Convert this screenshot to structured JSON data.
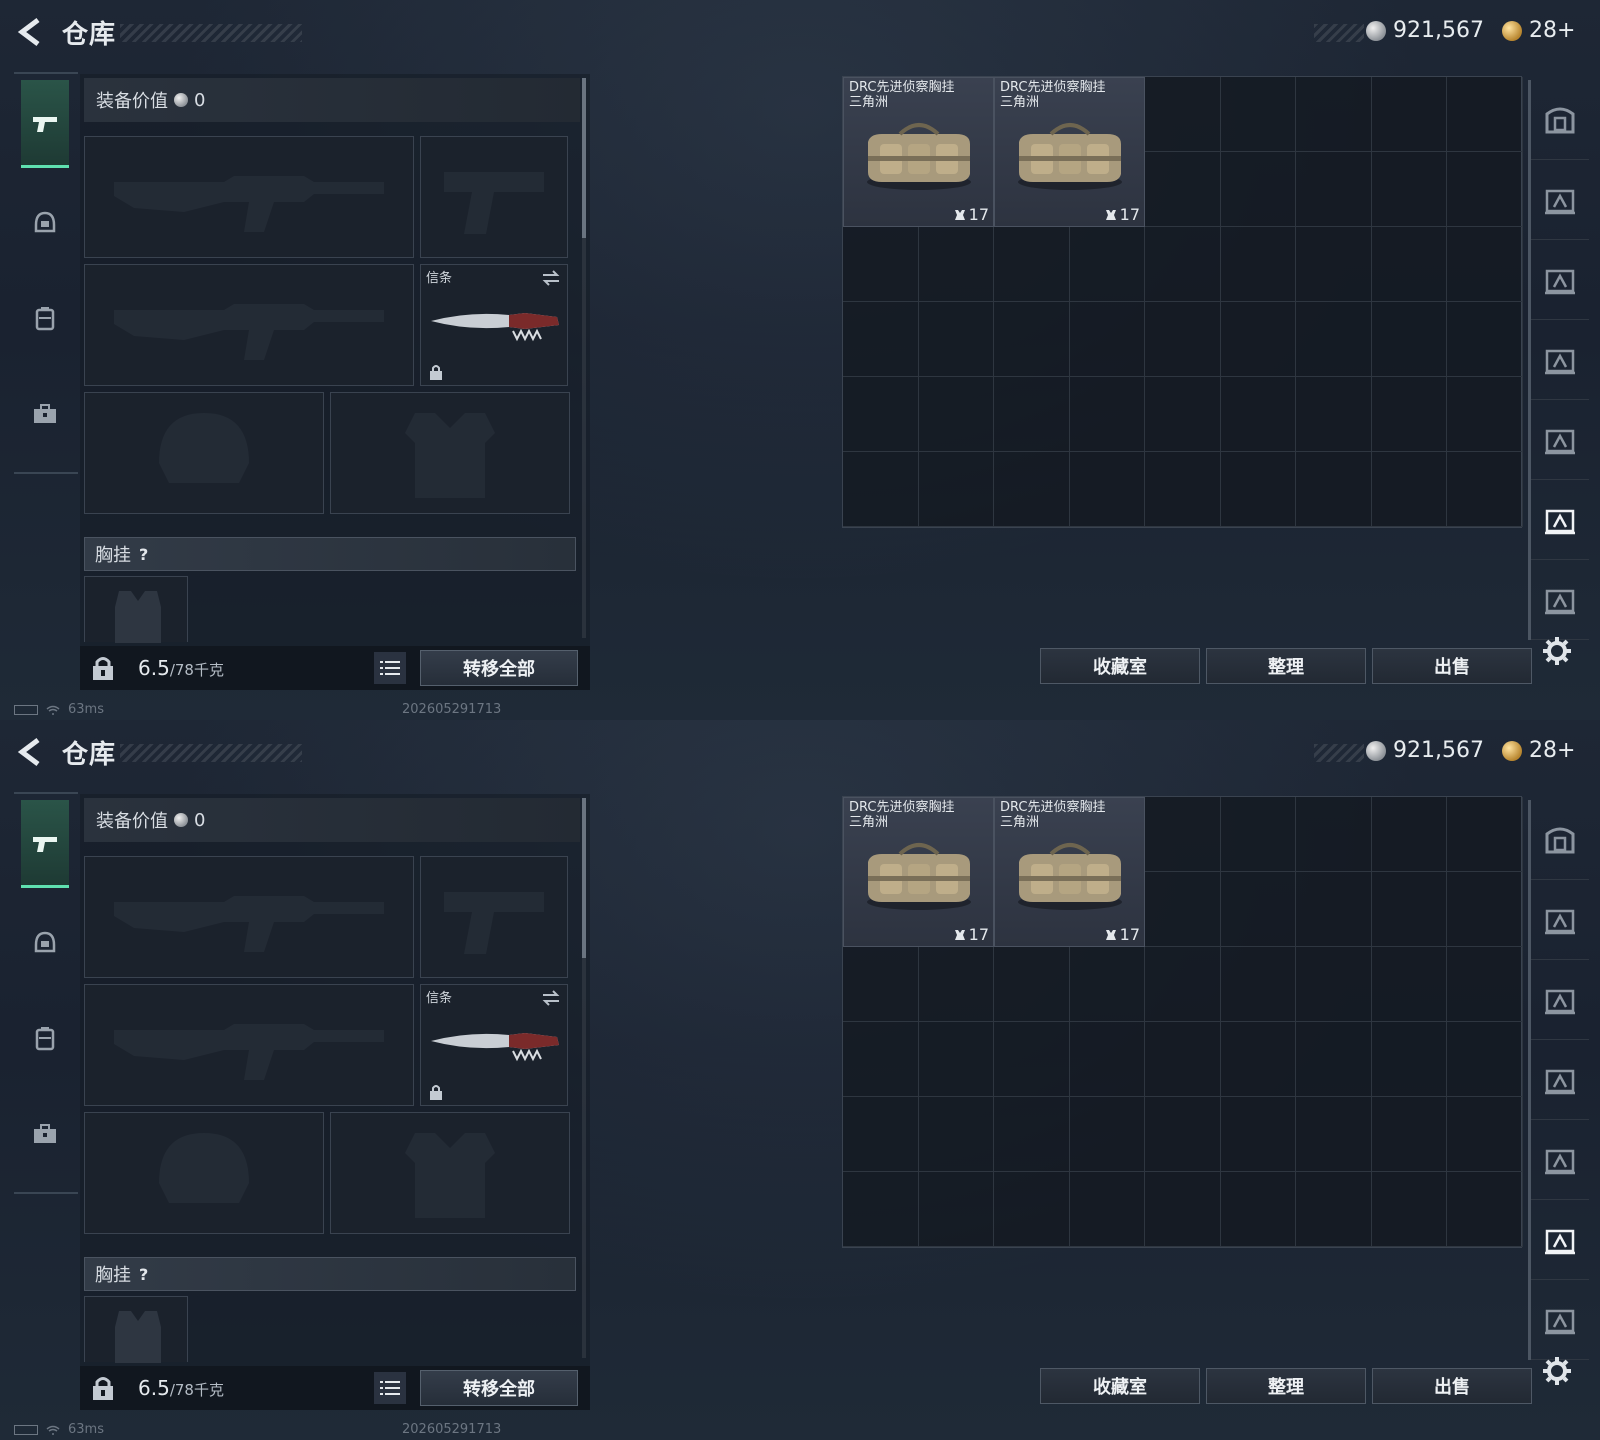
{
  "screens": [
    {
      "header": {
        "title": "仓库",
        "silver": "921,567",
        "gold": "28+"
      },
      "nav": [
        "pistol-icon",
        "helmet-icon",
        "backpack-icon",
        "toolbox-icon"
      ],
      "equip": {
        "value_label": "装备价值",
        "value": "0",
        "melee_label": "信条",
        "chest_label": "胸挂",
        "help": "?",
        "weight": "6.5",
        "weight_max": "/78千克",
        "transfer_all": "转移全部"
      },
      "storage": {
        "items": [
          {
            "name_line1": "DRC先进侦察胸挂",
            "name_line2": "三角洲",
            "count": "17"
          },
          {
            "name_line1": "DRC先进侦察胸挂",
            "name_line2": "三角洲",
            "count": "17"
          }
        ]
      },
      "actions": {
        "collection": "收藏室",
        "sort": "整理",
        "sell": "出售"
      },
      "status": {
        "ping": "63ms",
        "build": "202605291713"
      }
    },
    {
      "header": {
        "title": "仓库",
        "silver": "921,567",
        "gold": "28+"
      },
      "nav": [
        "pistol-icon",
        "helmet-icon",
        "backpack-icon",
        "toolbox-icon"
      ],
      "equip": {
        "value_label": "装备价值",
        "value": "0",
        "melee_label": "信条",
        "chest_label": "胸挂",
        "help": "?",
        "weight": "6.5",
        "weight_max": "/78千克",
        "transfer_all": "转移全部"
      },
      "storage": {
        "items": [
          {
            "name_line1": "DRC先进侦察胸挂",
            "name_line2": "三角洲",
            "count": "17"
          },
          {
            "name_line1": "DRC先进侦察胸挂",
            "name_line2": "三角洲",
            "count": "17"
          }
        ]
      },
      "actions": {
        "collection": "收藏室",
        "sort": "整理",
        "sell": "出售"
      },
      "status": {
        "ping": "63ms",
        "build": "202605291713"
      }
    }
  ],
  "colors": {
    "accent": "#5fe0b0",
    "background": "#1b2330",
    "panel": "#1b222c"
  }
}
